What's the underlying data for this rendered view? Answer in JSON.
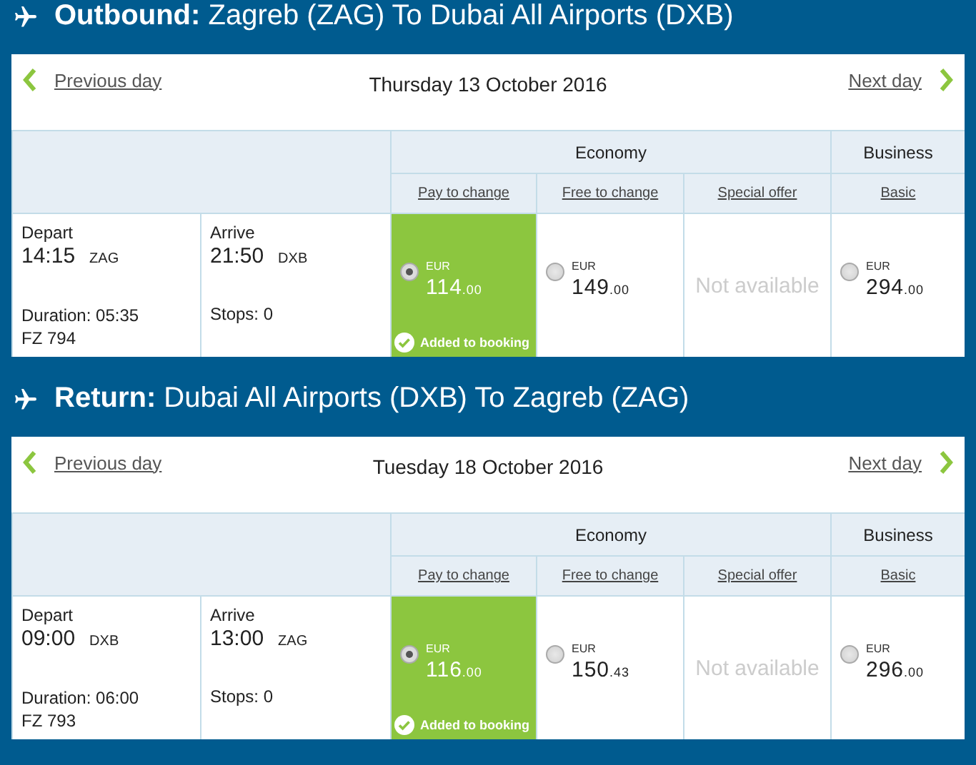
{
  "sections": [
    {
      "label": "Outbound:",
      "route": "Zagreb (ZAG) To Dubai All Airports (DXB)",
      "previous": "Previous day",
      "date": "Thursday 13 October 2016",
      "next": "Next day",
      "cabins": [
        {
          "label": "Economy"
        },
        {
          "label": "Business"
        }
      ],
      "fare_types": [
        "Pay to change",
        "Free to change",
        "Special offer",
        "Basic"
      ],
      "depart": {
        "label": "Depart",
        "time": "14:15",
        "airport": "ZAG"
      },
      "arrive": {
        "label": "Arrive",
        "time": "21:50",
        "airport": "DXB"
      },
      "duration": "Duration: 05:35",
      "flight": "FZ 794",
      "stops": "Stops: 0",
      "fares": [
        {
          "kind": "price",
          "selected": true,
          "currency": "EUR",
          "amount": "114",
          "fraction": ".00",
          "note": "Added to booking"
        },
        {
          "kind": "price",
          "selected": false,
          "currency": "EUR",
          "amount": "149",
          "fraction": ".00"
        },
        {
          "kind": "unavailable",
          "text": "Not available"
        },
        {
          "kind": "price",
          "selected": false,
          "currency": "EUR",
          "amount": "294",
          "fraction": ".00"
        }
      ]
    },
    {
      "label": "Return:",
      "route": "Dubai All Airports (DXB) To Zagreb (ZAG)",
      "previous": "Previous day",
      "date": "Tuesday 18 October 2016",
      "next": "Next day",
      "cabins": [
        {
          "label": "Economy"
        },
        {
          "label": "Business"
        }
      ],
      "fare_types": [
        "Pay to change",
        "Free to change",
        "Special offer",
        "Basic"
      ],
      "depart": {
        "label": "Depart",
        "time": "09:00",
        "airport": "DXB"
      },
      "arrive": {
        "label": "Arrive",
        "time": "13:00",
        "airport": "ZAG"
      },
      "duration": "Duration: 06:00",
      "flight": "FZ 793",
      "stops": "Stops: 0",
      "fares": [
        {
          "kind": "price",
          "selected": true,
          "currency": "EUR",
          "amount": "116",
          "fraction": ".00",
          "note": "Added to booking"
        },
        {
          "kind": "price",
          "selected": false,
          "currency": "EUR",
          "amount": "150",
          "fraction": ".43"
        },
        {
          "kind": "unavailable",
          "text": "Not available"
        },
        {
          "kind": "price",
          "selected": false,
          "currency": "EUR",
          "amount": "296",
          "fraction": ".00"
        }
      ]
    }
  ]
}
